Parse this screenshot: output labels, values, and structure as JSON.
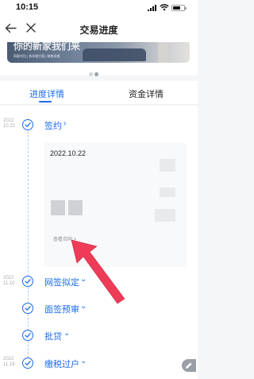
{
  "status_bar": {
    "time": "10:15"
  },
  "nav": {
    "title": "交易进度"
  },
  "banner": {
    "headline": "你的新家我们来",
    "subline": "同屏对比 | 多风格方案 | 装修灵感"
  },
  "tabs": [
    {
      "label": "进度详情",
      "active": true
    },
    {
      "label": "资金详情",
      "active": false
    }
  ],
  "steps": [
    {
      "date": "2022\n10.22",
      "label": "签约",
      "expanded": true
    },
    {
      "date": "2022\n11.10",
      "label": "网签拟定",
      "expanded": false
    },
    {
      "date": "",
      "label": "面签预审",
      "expanded": false
    },
    {
      "date": "",
      "label": "批贷",
      "expanded": false
    },
    {
      "date": "2022\n11.18",
      "label": "缴税过户",
      "expanded": false
    }
  ],
  "sign_card": {
    "date": "2022.10.22",
    "view_contract": "查看合同 >"
  },
  "colors": {
    "accent": "#1a6cf0",
    "annotation_arrow": "#ee3b57"
  }
}
